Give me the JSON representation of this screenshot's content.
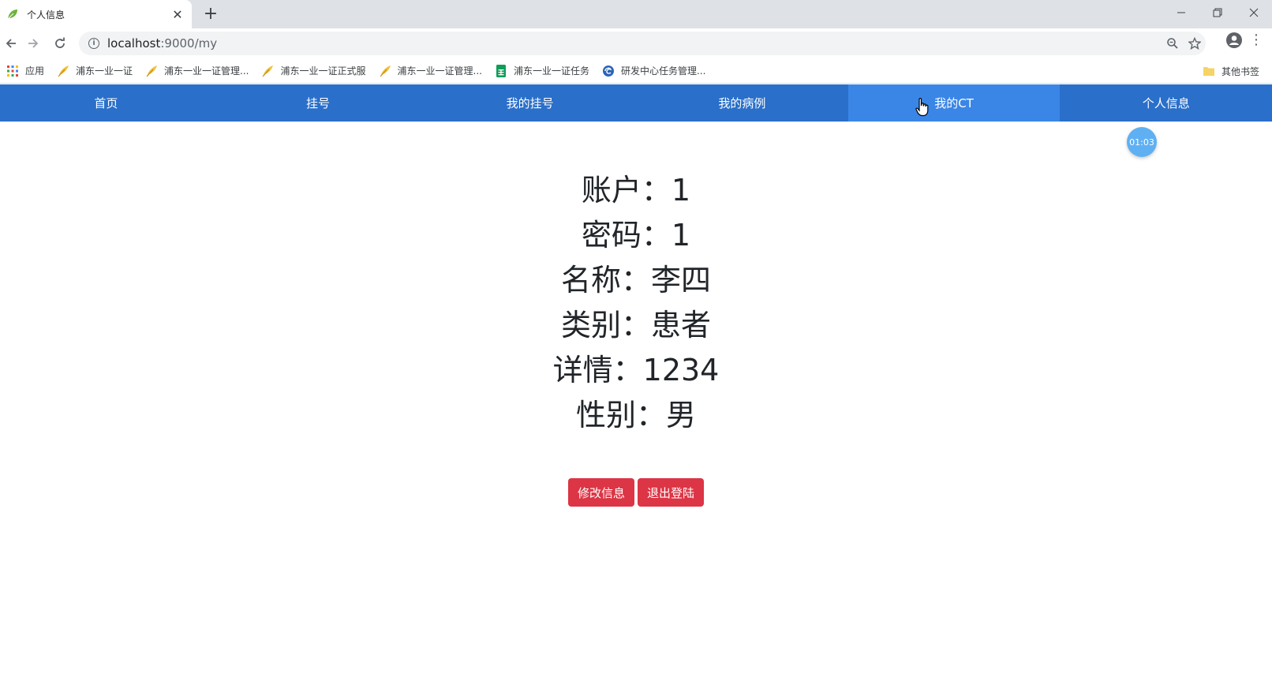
{
  "browser": {
    "tab_title": "个人信息",
    "url_host": "localhost",
    "url_path": ":9000/my",
    "bookmarks": [
      {
        "label": "应用",
        "icon": "apps-grid-icon"
      },
      {
        "label": "浦东一业一证",
        "icon": "feather-icon"
      },
      {
        "label": "浦东一业一证管理...",
        "icon": "feather-icon"
      },
      {
        "label": "浦东一业一证正式服",
        "icon": "feather-icon"
      },
      {
        "label": "浦东一业一证管理...",
        "icon": "feather-icon"
      },
      {
        "label": "浦东一业一证任务",
        "icon": "sheet-icon"
      },
      {
        "label": "研发中心任务管理...",
        "icon": "globe-icon"
      }
    ],
    "other_bookmarks": "其他书签"
  },
  "navbar": {
    "items": [
      "首页",
      "挂号",
      "我的挂号",
      "我的病例",
      "我的CT",
      "个人信息"
    ],
    "active_index": 4,
    "color": "#2a6fc9",
    "active_color": "#3a86e6"
  },
  "timer": "01:03",
  "profile": {
    "account_label": "账户：",
    "account_value": "1",
    "password_label": "密码：",
    "password_value": "1",
    "name_label": "名称：",
    "name_value": "李四",
    "type_label": "类别：",
    "type_value": "患者",
    "detail_label": "详情：",
    "detail_value": "1234",
    "gender_label": "性别：",
    "gender_value": "男"
  },
  "actions": {
    "edit_label": "修改信息",
    "logout_label": "退出登陆",
    "button_color": "#dc3545"
  }
}
